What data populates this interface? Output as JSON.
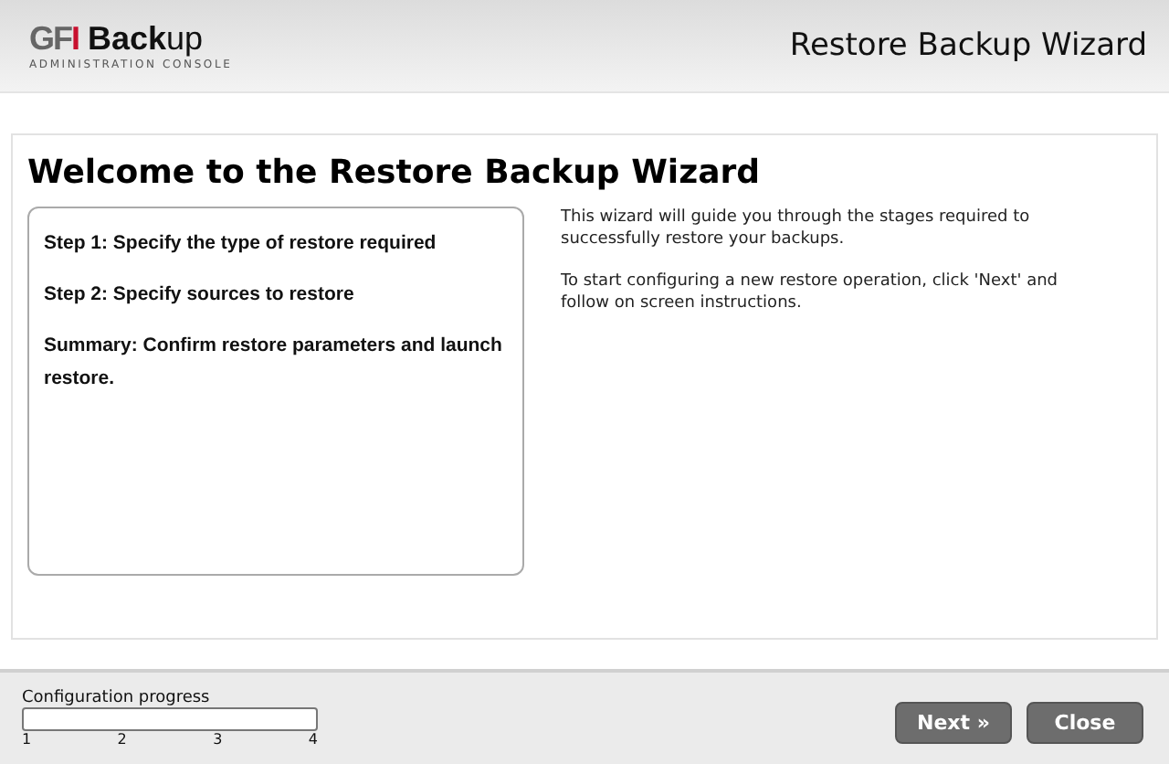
{
  "header": {
    "brand": "GFI",
    "product": "**Back**up",
    "subtitle": "ADMINISTRATION CONSOLE",
    "title": "Restore Backup Wizard"
  },
  "page": {
    "heading": "Welcome to the Restore Backup Wizard",
    "steps": [
      "Step 1: Specify the type of restore required",
      "Step 2: Specify sources to restore",
      "Summary: Confirm restore parameters and launch restore."
    ],
    "paragraphs": [
      "This wizard will guide you through the stages required to successfully restore your backups.",
      "To start configuring a new restore operation, click 'Next' and follow on screen instructions."
    ]
  },
  "footer": {
    "progress_label": "Configuration progress",
    "progress": {
      "level": 0
    },
    "ticks": [
      "1",
      "2",
      "3",
      "4"
    ],
    "buttons": [
      "Next »",
      "Close"
    ]
  }
}
